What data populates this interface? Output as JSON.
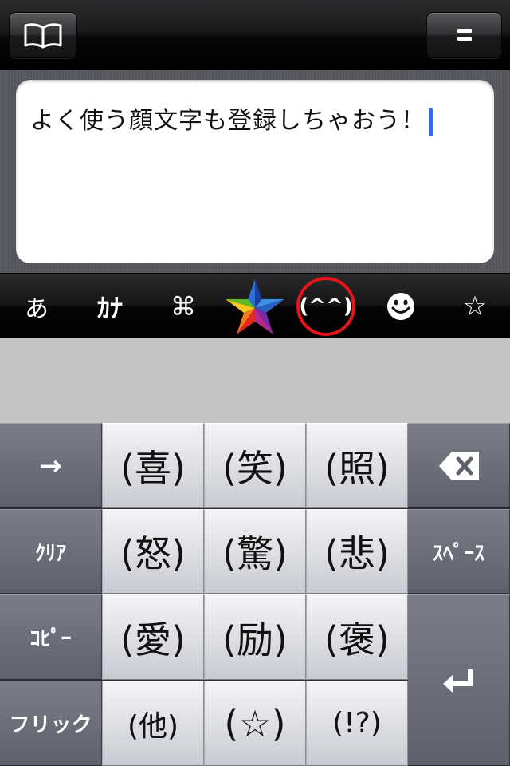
{
  "toolbar": {
    "left_icon": "open-book-icon",
    "right_icon": "menu-lines-icon"
  },
  "editor": {
    "text": "よく使う顔文字も登録しちゃおう！"
  },
  "mode_bar": {
    "items": [
      {
        "label": "あ"
      },
      {
        "label": "ｶﾅ"
      },
      {
        "label": "⌘"
      },
      {
        "icon": "colorful-star-icon"
      },
      {
        "label": "(^^)",
        "selected": true
      },
      {
        "icon": "smiley-face-icon"
      },
      {
        "label": "☆"
      }
    ],
    "highlight_color": "#e8141b"
  },
  "keyboard": {
    "side_left": [
      "→",
      "ｸﾘｱ",
      "ｺﾋﾟｰ",
      "フリック"
    ],
    "side_right": [
      "delete-backspace-icon",
      "ｽﾍﾟｰｽ",
      "return-enter-icon"
    ],
    "rows": [
      [
        "(喜)",
        "(笑)",
        "(照)"
      ],
      [
        "(怒)",
        "(驚)",
        "(悲)"
      ],
      [
        "(愛)",
        "(励)",
        "(褒)"
      ],
      [
        "(他)",
        "(☆)",
        "(!?)"
      ]
    ]
  }
}
